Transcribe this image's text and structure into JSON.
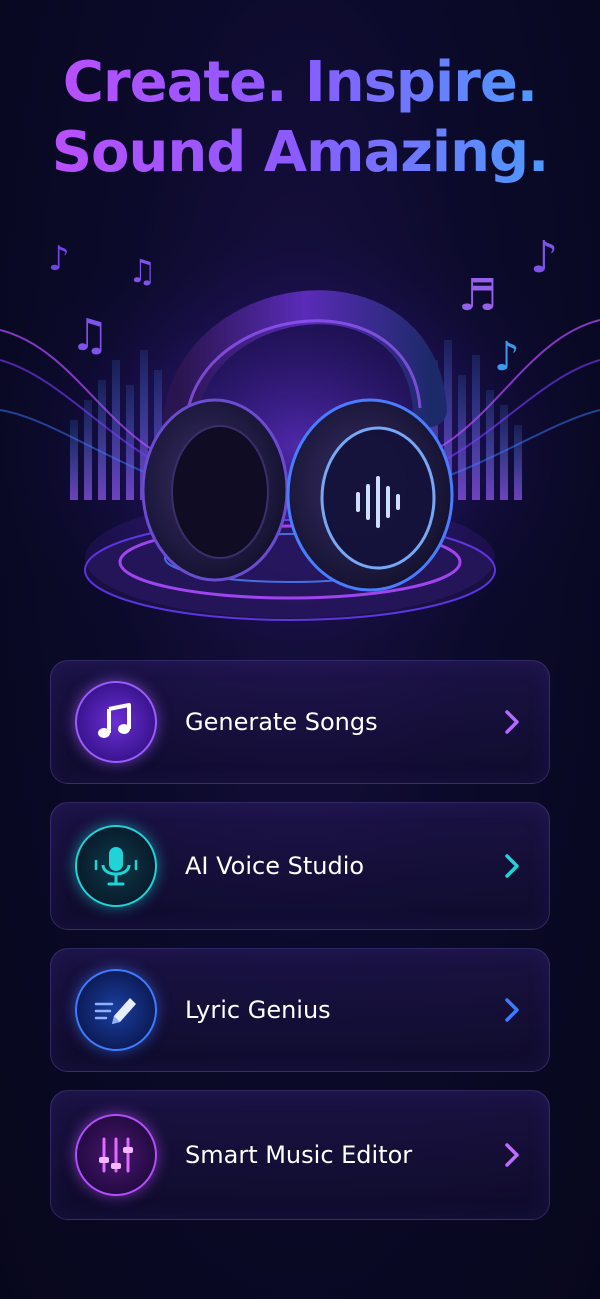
{
  "headline": {
    "line1": "Create. Inspire.",
    "line2": "Sound Amazing."
  },
  "hero": {
    "image": "headphones-on-glowing-platform",
    "decorations": [
      "music-note-icon",
      "equalizer-bars",
      "neon-waves"
    ]
  },
  "menu": {
    "items": [
      {
        "label": "Generate Songs",
        "icon": "music-note-icon",
        "accent": "#9b5cff"
      },
      {
        "label": "AI Voice Studio",
        "icon": "microphone-icon",
        "accent": "#1fd3d6"
      },
      {
        "label": "Lyric Genius",
        "icon": "pencil-icon",
        "accent": "#3c7cff"
      },
      {
        "label": "Smart Music Editor",
        "icon": "sliders-icon",
        "accent": "#b44dff"
      }
    ]
  },
  "colors": {
    "background": "#0b0a2a",
    "gradient_start": "#c44dff",
    "gradient_end": "#3fa9ff"
  }
}
